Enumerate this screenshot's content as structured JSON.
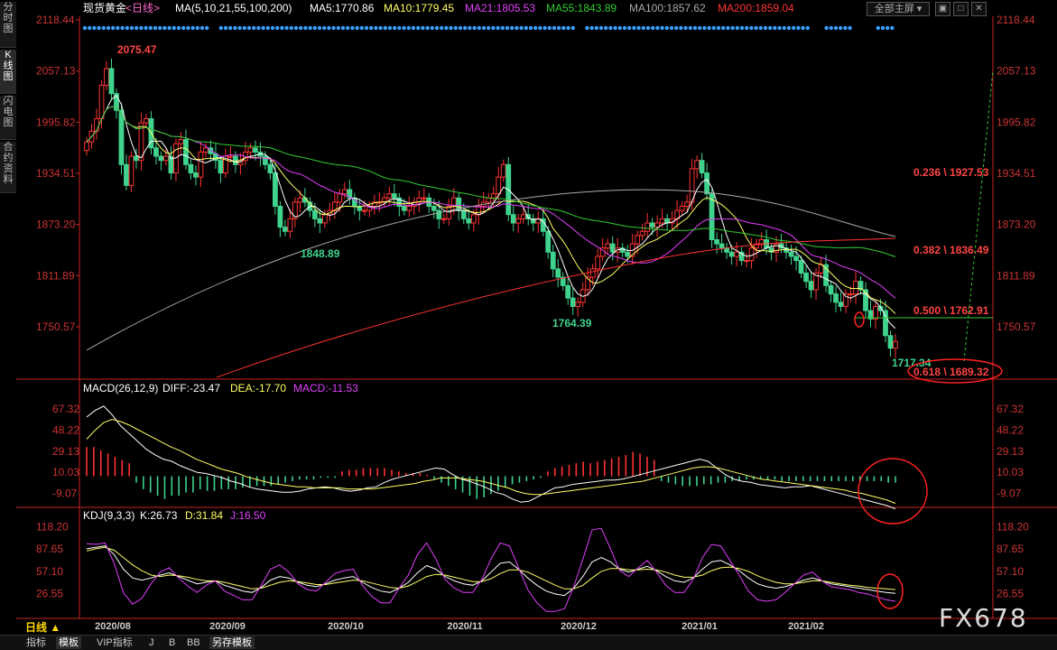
{
  "side_tabs": [
    "分时图",
    "K线图",
    "闪电图",
    "合约资料"
  ],
  "header": {
    "symbol": "现货黄金",
    "period": "<日线>",
    "ma_label": "MA(5,10,21,55,100,200)",
    "ma5": "MA5:1770.86",
    "ma10": "MA10:1779.45",
    "ma21": "MA21:1805.53",
    "ma55": "MA55:1843.89",
    "ma100": "MA100:1857.62",
    "ma200": "MA200:1859.04"
  },
  "toolbar": {
    "screen_label": "全部主屏",
    "btn1": "▣",
    "btn2": "□",
    "btn3": "✕"
  },
  "macd_header": {
    "label": "MACD(26,12,9)",
    "diff": "DIFF:-23.47",
    "dea": "DEA:-17.70",
    "macd": "MACD:-11.53"
  },
  "kdj_header": {
    "label": "KDJ(9,3,3)",
    "k": "K:26.73",
    "d": "D:31.84",
    "j": "J:16.50"
  },
  "bottom": {
    "period_button": "日线 ▲",
    "tabs": [
      "指标",
      "模板",
      "VIP指标",
      "J",
      "B",
      "BB",
      "另存模板"
    ]
  },
  "watermark": "FX678",
  "colors": {
    "up": "#ff3232",
    "down": "#3fd38e",
    "ma5": "#ffffff",
    "ma10": "#ffff66",
    "ma21": "#e040fb",
    "ma55": "#33cc33",
    "ma100": "#aaaaaa",
    "ma200": "#ff3333",
    "axis": "#cc2222"
  },
  "chart_data": [
    {
      "type": "candlestick",
      "title": "现货黄金 日线",
      "y_ticks": [
        "2118.44",
        "2057.13",
        "1995.82",
        "1934.51",
        "1873.20",
        "1811.89",
        "1750.57"
      ],
      "x_ticks": [
        "2020/08",
        "2020/09",
        "2020/10",
        "2020/11",
        "2020/12",
        "2021/01",
        "2021/02"
      ],
      "ylim": [
        1700,
        2130
      ],
      "annotations": {
        "high": "2075.47",
        "low1": "1848.89",
        "low2": "1764.39",
        "low3": "1717.34",
        "fib_236": "0.236 \\ 1927.53",
        "fib_382": "0.382 \\ 1836.49",
        "fib_500": "0.500 \\ 1762.91",
        "fib_618": "0.618 \\ 1689.32"
      },
      "close": [
        1972,
        1985,
        2000,
        2040,
        2060,
        2030,
        2010,
        1945,
        1920,
        1955,
        1950,
        1995,
        2000,
        1965,
        1955,
        1950,
        1955,
        1935,
        1970,
        1975,
        1945,
        1935,
        1930,
        1960,
        1965,
        1958,
        1950,
        1935,
        1955,
        1955,
        1945,
        1950,
        1960,
        1965,
        1960,
        1955,
        1945,
        1935,
        1895,
        1870,
        1865,
        1880,
        1900,
        1905,
        1900,
        1890,
        1880,
        1875,
        1885,
        1890,
        1900,
        1910,
        1915,
        1905,
        1895,
        1890,
        1890,
        1895,
        1900,
        1900,
        1905,
        1910,
        1905,
        1895,
        1890,
        1895,
        1900,
        1905,
        1905,
        1895,
        1890,
        1880,
        1880,
        1895,
        1905,
        1890,
        1880,
        1875,
        1885,
        1895,
        1900,
        1905,
        1910,
        1930,
        1945,
        1885,
        1875,
        1880,
        1885,
        1880,
        1875,
        1880,
        1865,
        1840,
        1820,
        1810,
        1800,
        1785,
        1775,
        1780,
        1795,
        1810,
        1820,
        1835,
        1845,
        1850,
        1840,
        1845,
        1840,
        1835,
        1850,
        1860,
        1865,
        1875,
        1870,
        1875,
        1880,
        1875,
        1880,
        1890,
        1895,
        1900,
        1940,
        1950,
        1935,
        1910,
        1855,
        1850,
        1845,
        1840,
        1835,
        1840,
        1830,
        1830,
        1845,
        1850,
        1855,
        1845,
        1840,
        1850,
        1845,
        1840,
        1835,
        1830,
        1815,
        1805,
        1795,
        1815,
        1825,
        1800,
        1790,
        1780,
        1775,
        1790,
        1790,
        1805,
        1795,
        1770,
        1760,
        1775,
        1770,
        1740,
        1725,
        1733
      ],
      "ma_lines": [
        "MA5",
        "MA10",
        "MA21",
        "MA55",
        "MA100",
        "MA200"
      ],
      "volume": null
    },
    {
      "type": "bar+line",
      "title": "MACD(26,12,9)",
      "y_ticks": [
        "67.32",
        "48.22",
        "29.13",
        "10.03",
        "-9.07"
      ],
      "ylim": [
        -20,
        78
      ],
      "series": [
        {
          "name": "DIFF",
          "values": [
            60,
            66,
            70,
            62,
            52,
            45,
            38,
            31,
            26,
            22,
            20,
            16,
            13,
            10,
            9,
            7,
            5,
            2,
            0,
            -3,
            -5,
            -6,
            -7,
            -8,
            -8,
            -7,
            -5,
            -4,
            -3,
            -4,
            -6,
            -7,
            -6,
            -4,
            -3,
            1,
            4,
            6,
            8,
            10,
            12,
            14,
            13,
            8,
            4,
            2,
            -1,
            -4,
            -8,
            -10,
            -14,
            -17,
            -16,
            -12,
            -8,
            -4,
            -3,
            -1,
            0,
            1,
            2,
            3,
            3,
            4,
            6,
            8,
            10,
            12,
            14,
            16,
            18,
            20,
            22,
            20,
            14,
            8,
            4,
            2,
            1,
            -1,
            -2,
            -3,
            -4,
            -3,
            -3,
            -2,
            -4,
            -6,
            -8,
            -10,
            -12,
            -14,
            -16,
            -18,
            -20,
            -23
          ]
        },
        {
          "name": "DEA",
          "values": [
            40,
            48,
            55,
            58,
            56,
            53,
            49,
            45,
            41,
            37,
            33,
            30,
            26,
            22,
            19,
            16,
            13,
            11,
            9,
            6,
            4,
            2,
            0,
            -1,
            -2,
            -3,
            -3,
            -4,
            -4,
            -4,
            -4,
            -5,
            -5,
            -5,
            -5,
            -4,
            -3,
            -2,
            -1,
            0,
            2,
            3,
            5,
            5,
            5,
            4,
            3,
            2,
            0,
            -2,
            -4,
            -7,
            -9,
            -10,
            -10,
            -9,
            -8,
            -7,
            -6,
            -5,
            -4,
            -3,
            -2,
            -1,
            0,
            1,
            2,
            4,
            6,
            8,
            10,
            12,
            14,
            15,
            15,
            14,
            12,
            10,
            8,
            6,
            4,
            3,
            2,
            1,
            0,
            -1,
            -2,
            -3,
            -4,
            -5,
            -6,
            -8,
            -9,
            -11,
            -13,
            -15,
            -18
          ]
        }
      ],
      "histogram": [
        18,
        18,
        16,
        14,
        12,
        10,
        8,
        -4,
        -8,
        -10,
        -12,
        -14,
        -12,
        -12,
        -10,
        -10,
        -8,
        -9,
        -9,
        -8,
        -8,
        -8,
        -7,
        -7,
        -6,
        -6,
        -6,
        -5,
        -4,
        -3,
        -2,
        -2,
        -2,
        -1,
        -1,
        -1,
        3,
        4,
        4,
        5,
        5,
        5,
        5,
        4,
        3,
        2,
        2,
        2,
        1,
        -2,
        -4,
        -6,
        -8,
        -10,
        -12,
        -14,
        -13,
        -11,
        -9,
        -7,
        -5,
        -4,
        -3,
        -2,
        -1,
        3,
        5,
        6,
        7,
        8,
        9,
        8,
        9,
        10,
        11,
        12,
        13,
        15,
        14,
        12,
        10,
        -3,
        -4,
        -5,
        -6,
        -6,
        -6,
        -5,
        -5,
        -4,
        -4,
        -3,
        -3,
        -2,
        -2,
        -2,
        -2,
        -2,
        -3,
        -3,
        -3,
        -3,
        -3,
        -3,
        -3,
        -3,
        -3,
        -3,
        -3,
        -3,
        -3,
        -3,
        -3,
        -4,
        -4
      ]
    },
    {
      "type": "line",
      "title": "KDJ(9,3,3)",
      "y_ticks": [
        "118.20",
        "87.65",
        "57.10",
        "26.55"
      ],
      "ylim": [
        -5,
        125
      ],
      "series": [
        {
          "name": "K",
          "values": [
            88,
            90,
            92,
            80,
            60,
            48,
            45,
            48,
            52,
            55,
            50,
            45,
            40,
            42,
            44,
            38,
            34,
            30,
            28,
            35,
            45,
            50,
            48,
            42,
            38,
            36,
            40,
            45,
            48,
            50,
            42,
            35,
            30,
            28,
            34,
            42,
            55,
            65,
            60,
            50,
            44,
            40,
            38,
            44,
            56,
            68,
            70,
            60,
            48,
            38,
            30,
            26,
            24,
            34,
            50,
            70,
            76,
            70,
            60,
            56,
            60,
            64,
            58,
            50,
            44,
            42,
            48,
            60,
            70,
            72,
            66,
            58,
            48,
            40,
            36,
            34,
            36,
            40,
            45,
            48,
            44,
            40,
            38,
            36,
            34,
            32,
            30,
            28,
            27
          ]
        },
        {
          "name": "D",
          "values": [
            85,
            88,
            90,
            86,
            76,
            66,
            58,
            52,
            50,
            52,
            51,
            49,
            46,
            44,
            44,
            42,
            39,
            36,
            33,
            34,
            38,
            42,
            44,
            43,
            41,
            39,
            39,
            41,
            43,
            45,
            44,
            41,
            38,
            35,
            34,
            37,
            43,
            50,
            53,
            52,
            49,
            46,
            43,
            43,
            47,
            54,
            59,
            59,
            56,
            50,
            44,
            38,
            33,
            33,
            38,
            48,
            57,
            61,
            61,
            59,
            59,
            60,
            59,
            56,
            52,
            49,
            49,
            52,
            58,
            62,
            63,
            61,
            57,
            51,
            46,
            42,
            40,
            40,
            42,
            44,
            44,
            42,
            40,
            38,
            37,
            35,
            34,
            33,
            32
          ]
        },
        {
          "name": "J",
          "values": [
            95,
            94,
            96,
            68,
            28,
            12,
            20,
            40,
            56,
            62,
            48,
            37,
            28,
            38,
            44,
            30,
            24,
            18,
            18,
            38,
            60,
            66,
            56,
            40,
            32,
            30,
            42,
            54,
            58,
            60,
            38,
            23,
            14,
            14,
            34,
            52,
            80,
            96,
            74,
            46,
            34,
            28,
            28,
            46,
            74,
            96,
            92,
            62,
            32,
            14,
            2,
            2,
            6,
            36,
            74,
            114,
            116,
            88,
            58,
            50,
            62,
            72,
            56,
            38,
            28,
            28,
            46,
            76,
            94,
            92,
            72,
            52,
            30,
            18,
            16,
            18,
            28,
            40,
            52,
            56,
            44,
            36,
            34,
            32,
            28,
            26,
            22,
            18,
            16
          ]
        }
      ]
    }
  ]
}
